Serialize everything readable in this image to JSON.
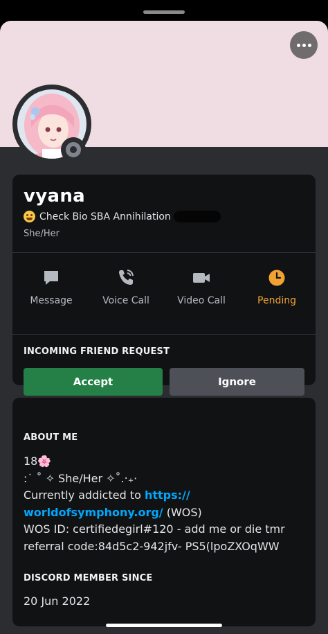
{
  "profile": {
    "display_name": "vyana",
    "custom_status": "Check Bio SBA Annihilation",
    "pronouns": "She/Her",
    "banner_color": "#f0dde4"
  },
  "actions": [
    {
      "label": "Message",
      "icon": "message-icon"
    },
    {
      "label": "Voice Call",
      "icon": "phone-icon"
    },
    {
      "label": "Video Call",
      "icon": "video-camera-icon"
    },
    {
      "label": "Pending",
      "icon": "clock-icon"
    }
  ],
  "friend_request": {
    "title": "INCOMING FRIEND REQUEST",
    "accept_label": "Accept",
    "ignore_label": "Ignore"
  },
  "about": {
    "title": "ABOUT ME",
    "line1": "18🌸",
    "line2": ":˙ ˚ ✧ She/Her ✧˚.‧₊·",
    "line3_prefix": "Currently addicted to ",
    "link_part1": "https://",
    "link_part2": "worldofsymphony.org/",
    "line4_suffix": " (WOS)",
    "line5": "WOS ID: certifiedegirl#120 - add me or die tmr",
    "line6": "referral code:84d5c2-942jfv- PS5(lpoZXOqWW"
  },
  "member_since": {
    "title": "DISCORD MEMBER SINCE",
    "date": "20 Jun 2022"
  },
  "colors": {
    "accent_green": "#248046",
    "pending_orange": "#f0a332",
    "link_blue": "#00a8fc"
  }
}
